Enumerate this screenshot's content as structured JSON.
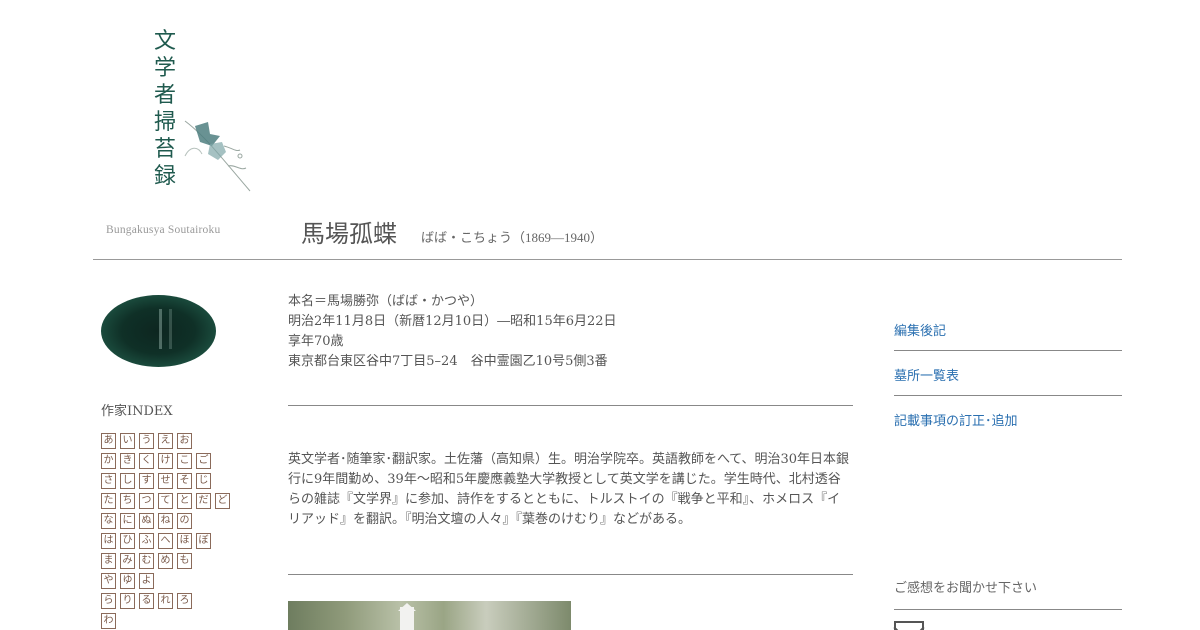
{
  "logo": {
    "title_vertical": "文学者掃苔録",
    "title_roman": "Bungakusya Soutairoku"
  },
  "header": {
    "name": "馬場孤蝶",
    "reading": "ばば・こちょう（1869―1940）"
  },
  "info": {
    "real_name": "本名＝馬場勝弥（ばば・かつや）",
    "dates": "明治2年11月8日（新暦12月10日）―昭和15年6月22日",
    "age": "享年70歳",
    "grave_location": "東京都台東区谷中7丁目5–24　谷中霊園乙10号5側3番"
  },
  "bio": {
    "text": "英文学者･随筆家･翻訳家。土佐藩（高知県）生。明治学院卒。英語教師をへて、明治30年日本銀行に9年間勤め、39年〜昭和5年慶應義塾大学教授として英文学を講じた。学生時代、北村透谷らの雑誌『文学界』に参加、詩作をするとともに、トルストイの『戦争と平和』、ホメロス『イリアッド』を翻訳。『明治文壇の人々』『葉巻のけむり』などがある。"
  },
  "sidebar": {
    "index_title": "作家INDEX",
    "kana_rows": [
      [
        "あ",
        "い",
        "う",
        "え",
        "お"
      ],
      [
        "か",
        "き",
        "く",
        "け",
        "こ",
        "ご"
      ],
      [
        "さ",
        "し",
        "す",
        "せ",
        "そ",
        "じ"
      ],
      [
        "た",
        "ち",
        "つ",
        "て",
        "と",
        "だ",
        "ど"
      ],
      [
        "な",
        "に",
        "ぬ",
        "ね",
        "の"
      ],
      [
        "は",
        "ひ",
        "ふ",
        "へ",
        "ほ",
        "ぼ"
      ],
      [
        "ま",
        "み",
        "む",
        "め",
        "も"
      ],
      [
        "や",
        "ゆ",
        "よ"
      ],
      [
        "ら",
        "り",
        "る",
        "れ",
        "ろ"
      ],
      [
        "わ"
      ]
    ]
  },
  "right_nav": {
    "links": [
      "編集後記",
      "墓所一覧表",
      "記載事項の訂正･追加"
    ],
    "feedback_label": "ご感想をお聞かせ下さい"
  },
  "colors": {
    "link": "#2a6fb0",
    "logo_green": "#1f5a4e",
    "kana_border": "#8a6a5a"
  }
}
